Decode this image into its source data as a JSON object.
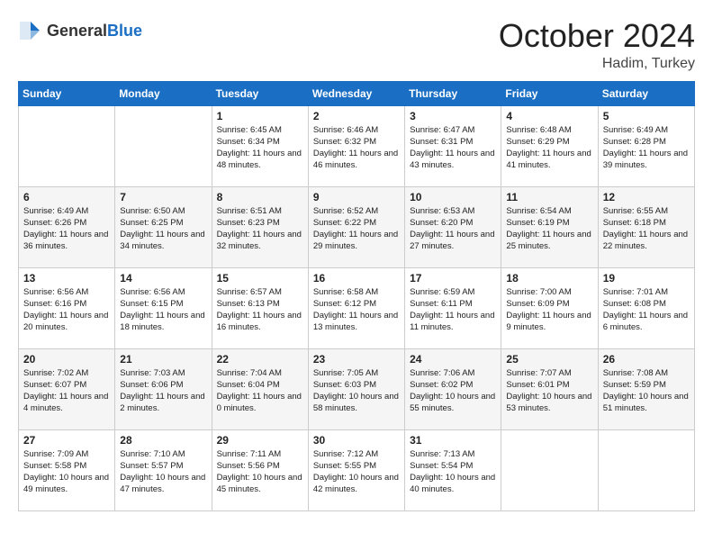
{
  "header": {
    "logo_general": "General",
    "logo_blue": "Blue",
    "month_title": "October 2024",
    "location": "Hadim, Turkey"
  },
  "weekdays": [
    "Sunday",
    "Monday",
    "Tuesday",
    "Wednesday",
    "Thursday",
    "Friday",
    "Saturday"
  ],
  "weeks": [
    [
      {
        "day": "",
        "sunrise": "",
        "sunset": "",
        "daylight": ""
      },
      {
        "day": "",
        "sunrise": "",
        "sunset": "",
        "daylight": ""
      },
      {
        "day": "1",
        "sunrise": "Sunrise: 6:45 AM",
        "sunset": "Sunset: 6:34 PM",
        "daylight": "Daylight: 11 hours and 48 minutes."
      },
      {
        "day": "2",
        "sunrise": "Sunrise: 6:46 AM",
        "sunset": "Sunset: 6:32 PM",
        "daylight": "Daylight: 11 hours and 46 minutes."
      },
      {
        "day": "3",
        "sunrise": "Sunrise: 6:47 AM",
        "sunset": "Sunset: 6:31 PM",
        "daylight": "Daylight: 11 hours and 43 minutes."
      },
      {
        "day": "4",
        "sunrise": "Sunrise: 6:48 AM",
        "sunset": "Sunset: 6:29 PM",
        "daylight": "Daylight: 11 hours and 41 minutes."
      },
      {
        "day": "5",
        "sunrise": "Sunrise: 6:49 AM",
        "sunset": "Sunset: 6:28 PM",
        "daylight": "Daylight: 11 hours and 39 minutes."
      }
    ],
    [
      {
        "day": "6",
        "sunrise": "Sunrise: 6:49 AM",
        "sunset": "Sunset: 6:26 PM",
        "daylight": "Daylight: 11 hours and 36 minutes."
      },
      {
        "day": "7",
        "sunrise": "Sunrise: 6:50 AM",
        "sunset": "Sunset: 6:25 PM",
        "daylight": "Daylight: 11 hours and 34 minutes."
      },
      {
        "day": "8",
        "sunrise": "Sunrise: 6:51 AM",
        "sunset": "Sunset: 6:23 PM",
        "daylight": "Daylight: 11 hours and 32 minutes."
      },
      {
        "day": "9",
        "sunrise": "Sunrise: 6:52 AM",
        "sunset": "Sunset: 6:22 PM",
        "daylight": "Daylight: 11 hours and 29 minutes."
      },
      {
        "day": "10",
        "sunrise": "Sunrise: 6:53 AM",
        "sunset": "Sunset: 6:20 PM",
        "daylight": "Daylight: 11 hours and 27 minutes."
      },
      {
        "day": "11",
        "sunrise": "Sunrise: 6:54 AM",
        "sunset": "Sunset: 6:19 PM",
        "daylight": "Daylight: 11 hours and 25 minutes."
      },
      {
        "day": "12",
        "sunrise": "Sunrise: 6:55 AM",
        "sunset": "Sunset: 6:18 PM",
        "daylight": "Daylight: 11 hours and 22 minutes."
      }
    ],
    [
      {
        "day": "13",
        "sunrise": "Sunrise: 6:56 AM",
        "sunset": "Sunset: 6:16 PM",
        "daylight": "Daylight: 11 hours and 20 minutes."
      },
      {
        "day": "14",
        "sunrise": "Sunrise: 6:56 AM",
        "sunset": "Sunset: 6:15 PM",
        "daylight": "Daylight: 11 hours and 18 minutes."
      },
      {
        "day": "15",
        "sunrise": "Sunrise: 6:57 AM",
        "sunset": "Sunset: 6:13 PM",
        "daylight": "Daylight: 11 hours and 16 minutes."
      },
      {
        "day": "16",
        "sunrise": "Sunrise: 6:58 AM",
        "sunset": "Sunset: 6:12 PM",
        "daylight": "Daylight: 11 hours and 13 minutes."
      },
      {
        "day": "17",
        "sunrise": "Sunrise: 6:59 AM",
        "sunset": "Sunset: 6:11 PM",
        "daylight": "Daylight: 11 hours and 11 minutes."
      },
      {
        "day": "18",
        "sunrise": "Sunrise: 7:00 AM",
        "sunset": "Sunset: 6:09 PM",
        "daylight": "Daylight: 11 hours and 9 minutes."
      },
      {
        "day": "19",
        "sunrise": "Sunrise: 7:01 AM",
        "sunset": "Sunset: 6:08 PM",
        "daylight": "Daylight: 11 hours and 6 minutes."
      }
    ],
    [
      {
        "day": "20",
        "sunrise": "Sunrise: 7:02 AM",
        "sunset": "Sunset: 6:07 PM",
        "daylight": "Daylight: 11 hours and 4 minutes."
      },
      {
        "day": "21",
        "sunrise": "Sunrise: 7:03 AM",
        "sunset": "Sunset: 6:06 PM",
        "daylight": "Daylight: 11 hours and 2 minutes."
      },
      {
        "day": "22",
        "sunrise": "Sunrise: 7:04 AM",
        "sunset": "Sunset: 6:04 PM",
        "daylight": "Daylight: 11 hours and 0 minutes."
      },
      {
        "day": "23",
        "sunrise": "Sunrise: 7:05 AM",
        "sunset": "Sunset: 6:03 PM",
        "daylight": "Daylight: 10 hours and 58 minutes."
      },
      {
        "day": "24",
        "sunrise": "Sunrise: 7:06 AM",
        "sunset": "Sunset: 6:02 PM",
        "daylight": "Daylight: 10 hours and 55 minutes."
      },
      {
        "day": "25",
        "sunrise": "Sunrise: 7:07 AM",
        "sunset": "Sunset: 6:01 PM",
        "daylight": "Daylight: 10 hours and 53 minutes."
      },
      {
        "day": "26",
        "sunrise": "Sunrise: 7:08 AM",
        "sunset": "Sunset: 5:59 PM",
        "daylight": "Daylight: 10 hours and 51 minutes."
      }
    ],
    [
      {
        "day": "27",
        "sunrise": "Sunrise: 7:09 AM",
        "sunset": "Sunset: 5:58 PM",
        "daylight": "Daylight: 10 hours and 49 minutes."
      },
      {
        "day": "28",
        "sunrise": "Sunrise: 7:10 AM",
        "sunset": "Sunset: 5:57 PM",
        "daylight": "Daylight: 10 hours and 47 minutes."
      },
      {
        "day": "29",
        "sunrise": "Sunrise: 7:11 AM",
        "sunset": "Sunset: 5:56 PM",
        "daylight": "Daylight: 10 hours and 45 minutes."
      },
      {
        "day": "30",
        "sunrise": "Sunrise: 7:12 AM",
        "sunset": "Sunset: 5:55 PM",
        "daylight": "Daylight: 10 hours and 42 minutes."
      },
      {
        "day": "31",
        "sunrise": "Sunrise: 7:13 AM",
        "sunset": "Sunset: 5:54 PM",
        "daylight": "Daylight: 10 hours and 40 minutes."
      },
      {
        "day": "",
        "sunrise": "",
        "sunset": "",
        "daylight": ""
      },
      {
        "day": "",
        "sunrise": "",
        "sunset": "",
        "daylight": ""
      }
    ]
  ]
}
